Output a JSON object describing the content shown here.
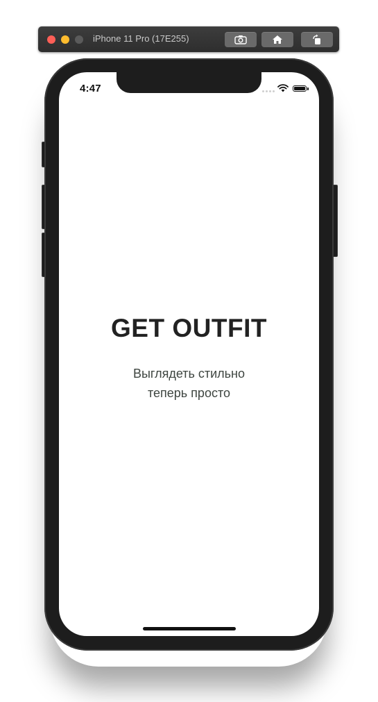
{
  "simulator": {
    "title": "iPhone 11 Pro (17E255)",
    "buttons": [
      "screenshot-icon",
      "home-icon",
      "rotate-icon"
    ]
  },
  "status_bar": {
    "time": "4:47"
  },
  "app": {
    "title": "GET OUTFIT",
    "tagline_line1": "Выглядеть стильно",
    "tagline_line2": "теперь просто"
  },
  "colors": {
    "title": "#222222",
    "tagline": "#3e4540",
    "device_frame": "#1d1d1d",
    "screen_background": "#ffffff"
  }
}
